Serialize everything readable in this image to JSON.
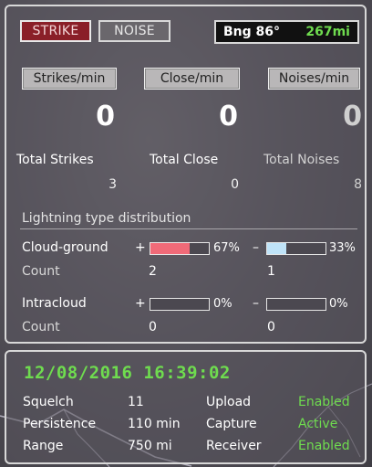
{
  "mode_buttons": {
    "strike": "STRIKE",
    "noise": "NOISE"
  },
  "bearing": {
    "label": "Bng 86°",
    "distance": "267mi"
  },
  "rates": {
    "strikes_label": "Strikes/min",
    "strikes_value": "0",
    "close_label": "Close/min",
    "close_value": "0",
    "noises_label": "Noises/min",
    "noises_value": "0"
  },
  "totals": {
    "strikes_label": "Total Strikes",
    "strikes_value": "3",
    "close_label": "Total Close",
    "close_value": "0",
    "noises_label": "Total Noises",
    "noises_value": "8"
  },
  "distribution": {
    "title": "Lightning type distribution",
    "rows": [
      {
        "label": "Cloud-ground",
        "positive": {
          "sign": "+",
          "percent": "67%",
          "fraction": 0.67,
          "color": "#f06a78",
          "count": "2"
        },
        "negative": {
          "sign": "–",
          "percent": "33%",
          "fraction": 0.33,
          "color": "#bfe3f8",
          "count": "1"
        },
        "count_label": "Count"
      },
      {
        "label": "Intracloud",
        "positive": {
          "sign": "+",
          "percent": "0%",
          "fraction": 0,
          "color": "#f06a78",
          "count": "0"
        },
        "negative": {
          "sign": "–",
          "percent": "0%",
          "fraction": 0,
          "color": "#bfe3f8",
          "count": "0"
        },
        "count_label": "Count"
      }
    ]
  },
  "status": {
    "datetime": "12/08/2016 16:39:02",
    "squelch_label": "Squelch",
    "squelch_value": "11",
    "persistence_label": "Persistence",
    "persistence_value": "110 min",
    "range_label": "Range",
    "range_value": "750 mi",
    "upload_label": "Upload",
    "upload_value": "Enabled",
    "capture_label": "Capture",
    "capture_value": "Active",
    "receiver_label": "Receiver",
    "receiver_value": "Enabled"
  },
  "colors": {
    "accent_green": "#6fdc4f",
    "strike_red": "#8a1f28"
  }
}
